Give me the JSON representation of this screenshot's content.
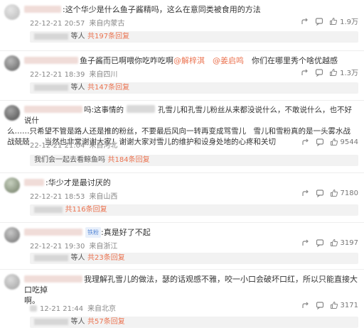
{
  "comments": [
    {
      "text": ":这个华少是什么鱼子酱精吗，这么在意同类被食用的方法",
      "time": "22-12-21 20:57",
      "location": "来自内蒙古",
      "reply_label": "等人",
      "reply_count": "共197条回复",
      "likes": "1.9万"
    },
    {
      "text_pre": "鱼子酱而已啊喂你吃咋吃啊",
      "mentions": [
        "@解梓淇",
        "@姜启鸣"
      ],
      "text_post": "你们在哪里秀个啥优越感",
      "time": "22-12-21 18:39",
      "location": "来自四川",
      "reply_label": "等人",
      "reply_count": "共147条回复",
      "likes": "1.3万"
    },
    {
      "line1_suffix": "吗:这事情的",
      "line1_tail": "孔雪儿和孔雪儿粉丝从来都没说什么，不敢说什么，也不好说什",
      "line2": "么……只希望不管是路人还是推的粉丝，不要最后风向一转再变成骂雪儿　雪儿和雪粉真的是一头雾水战",
      "line3": "战兢兢　　当然也非常谢谢大家！谢谢大家对雪儿的维护和设身处地的心疼和关切",
      "time": "22-12-21 21:04",
      "location": "来自河北",
      "reply_banner": "我们会一起去看鲸鱼吗",
      "reply_count": "共184条回复",
      "likes": "9544"
    },
    {
      "text": ":华少才是最讨厌的",
      "time": "22-12-21 18:53",
      "location": "来自山西",
      "reply_count": "共116条回复",
      "likes": "7180"
    },
    {
      "badge": "铁粉",
      "text": ":真是好了不起",
      "time": "22-12-21 19:30",
      "location": "来自浙江",
      "reply_label": "等人",
      "reply_count": "共23条回复",
      "likes": "3197"
    },
    {
      "line1": "我理解孔雪儿的做法，瑟的话观感不雅，咬一小口会破坏口红，所以只能直接大口吃掉",
      "line2": "啊。",
      "time": "12-21 21:44",
      "location": "来自北京",
      "reply_label": "等人",
      "reply_count": "共57条回复",
      "likes": "3171"
    }
  ]
}
